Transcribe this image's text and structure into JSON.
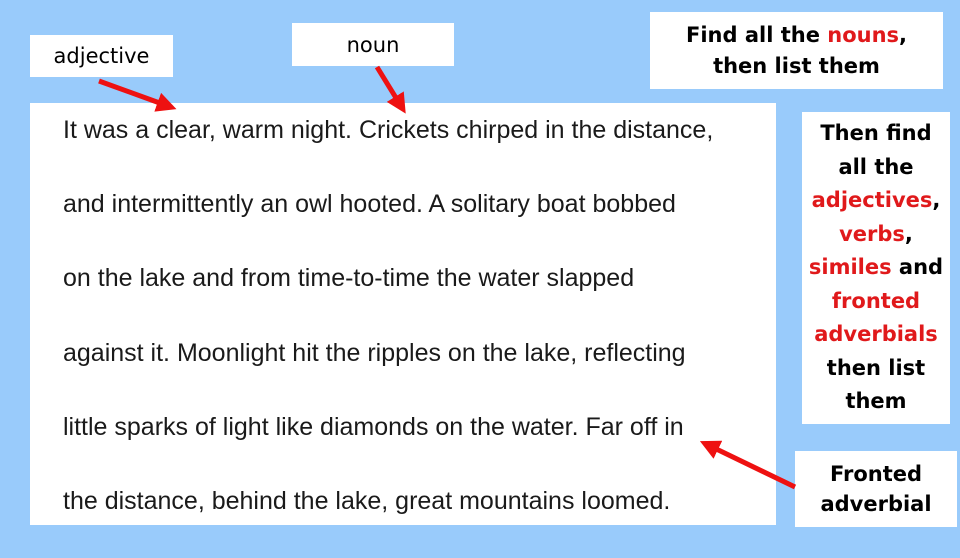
{
  "labels": {
    "adjective": "adjective",
    "noun": "noun",
    "fronted_adverbial": [
      "Fronted",
      "adverbial"
    ]
  },
  "instructions": {
    "nouns": {
      "part1": "Find all the ",
      "highlight": "nouns",
      "part2": ", then list them"
    },
    "more": {
      "line1": "Then find all the",
      "adjectives": "adjectives",
      "comma1": ",",
      "verbs": "verbs",
      "comma2": ",",
      "similes": "similes",
      "and": " and",
      "fronted_adverbials": "fronted adverbials",
      "tail": "then list them"
    }
  },
  "passage": {
    "lines": [
      "It was a clear, warm night. Crickets chirped in the distance,",
      "and intermittently an owl hooted. A solitary boat bobbed",
      "on the lake and from time-to-time the water slapped",
      "against it. Moonlight hit the ripples on the lake, reflecting",
      "little sparks of light like diamonds on the water. Far off in",
      "the distance, behind the lake, great mountains loomed."
    ]
  },
  "colors": {
    "background": "#99cbfb",
    "highlight": "#e0191b",
    "arrow": "#ee1111"
  }
}
